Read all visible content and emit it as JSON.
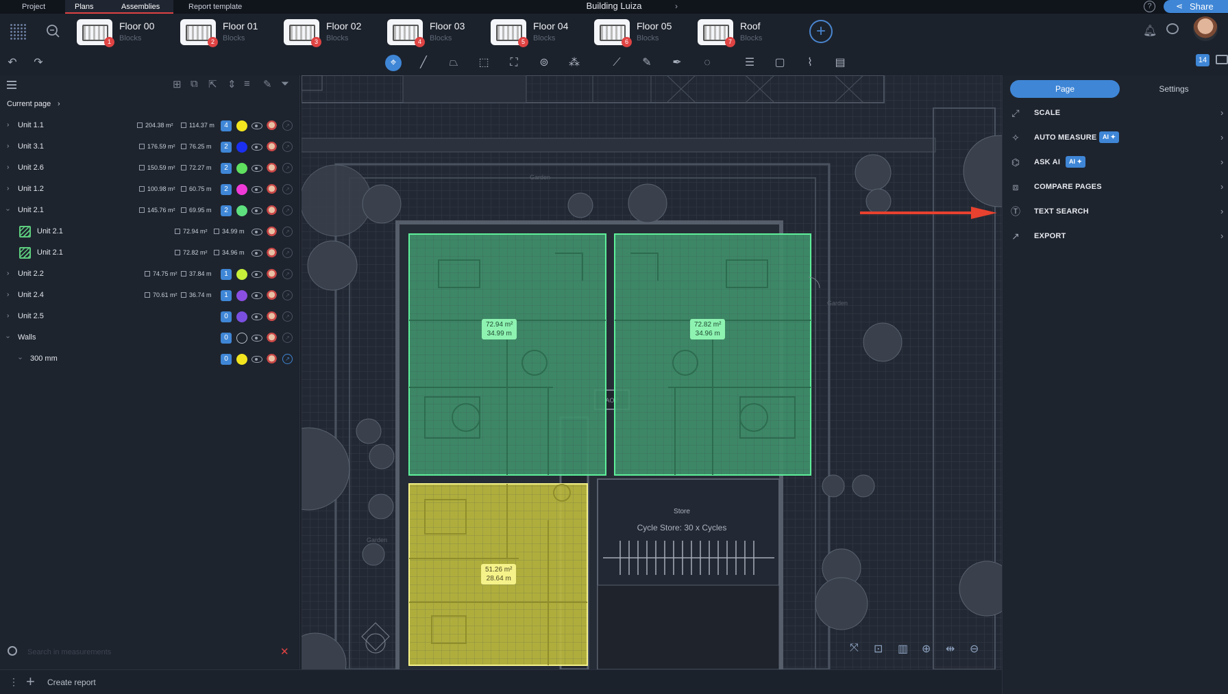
{
  "top_tabs": [
    "Project",
    "Plans",
    "Assemblies",
    "Report template"
  ],
  "active_tab": "Plans",
  "document_title": "Building Luiza",
  "share_label": "Share",
  "plans": [
    {
      "name": "Floor 00",
      "sub": "Blocks",
      "badge": "1"
    },
    {
      "name": "Floor 01",
      "sub": "Blocks",
      "badge": "2"
    },
    {
      "name": "Floor 02",
      "sub": "Blocks",
      "badge": "3"
    },
    {
      "name": "Floor 03",
      "sub": "Blocks",
      "badge": "4"
    },
    {
      "name": "Floor 04",
      "sub": "Blocks",
      "badge": "5"
    },
    {
      "name": "Floor 05",
      "sub": "Blocks",
      "badge": "6"
    },
    {
      "name": "Roof",
      "sub": "Blocks",
      "badge": "7"
    }
  ],
  "toolbar_count": "14",
  "breadcrumb": "Current page",
  "tree": [
    {
      "name": "Unit 1.1",
      "area": "204.38 m²",
      "length": "114.37 m",
      "count": "4",
      "color": "#f2e51f",
      "expanded": false
    },
    {
      "name": "Unit 3.1",
      "area": "176.59 m²",
      "length": "76.25 m",
      "count": "2",
      "color": "#1a2ff0",
      "expanded": false
    },
    {
      "name": "Unit 2.6",
      "area": "150.59 m²",
      "length": "72.27 m",
      "count": "2",
      "color": "#5fe05f",
      "expanded": false
    },
    {
      "name": "Unit 1.2",
      "area": "100.98 m²",
      "length": "60.75 m",
      "count": "2",
      "color": "#f03ad8",
      "expanded": false
    },
    {
      "name": "Unit 2.1",
      "area": "145.76 m²",
      "length": "69.95 m",
      "count": "2",
      "color": "#5fe07f",
      "expanded": true
    },
    {
      "name": "Unit 2.1",
      "area": "72.94 m²",
      "length": "34.99 m",
      "child": true
    },
    {
      "name": "Unit 2.1",
      "area": "72.82 m²",
      "length": "34.96 m",
      "child": true
    },
    {
      "name": "Unit 2.2",
      "area": "74.75 m²",
      "length": "37.84 m",
      "count": "1",
      "color": "#c6f03a",
      "expanded": false
    },
    {
      "name": "Unit 2.4",
      "area": "70.61 m²",
      "length": "36.74 m",
      "count": "1",
      "color": "#8a4fe0",
      "expanded": false
    },
    {
      "name": "Unit 2.5",
      "area": "",
      "length": "",
      "count": "0",
      "color": "#7a4fe0",
      "expanded": false
    },
    {
      "name": "Walls",
      "area": "",
      "length": "",
      "count": "0",
      "color": "none",
      "expanded": true
    },
    {
      "name": "300 mm",
      "area": "",
      "length": "",
      "count": "0",
      "color": "#f2e51f",
      "expanded": true,
      "sub": true
    }
  ],
  "search_placeholder": "Search in measurements",
  "create_report": "Create report",
  "canvas_labels": [
    {
      "area": "72.94 m²",
      "length": "34.99 m"
    },
    {
      "area": "72.82 m²",
      "length": "34.96 m"
    },
    {
      "area": "51.26 m²",
      "length": "28.64 m"
    }
  ],
  "plan_texts": {
    "cycle_store": "Cycle Store: 30 x Cycles",
    "store": "Store",
    "aov": "AOV",
    "garden": "Garden"
  },
  "right_segments": [
    "Page",
    "Settings"
  ],
  "active_segment": "Page",
  "right_menu": [
    {
      "label": "SCALE",
      "icon": "scale-icon",
      "ai": ""
    },
    {
      "label": "AUTO MEASURE",
      "icon": "auto-measure-icon",
      "ai": "AI ✦"
    },
    {
      "label": "ASK AI",
      "icon": "ask-ai-icon",
      "ai": "AI ✦"
    },
    {
      "label": "COMPARE PAGES",
      "icon": "compare-icon",
      "ai": ""
    },
    {
      "label": "TEXT SEARCH",
      "icon": "text-search-icon",
      "ai": ""
    },
    {
      "label": "EXPORT",
      "icon": "export-icon",
      "ai": ""
    }
  ],
  "colors": {
    "accent": "#3f86d6",
    "alert": "#e04343",
    "green_area": "#5fd08f",
    "yellow_area": "#e8e24f"
  }
}
